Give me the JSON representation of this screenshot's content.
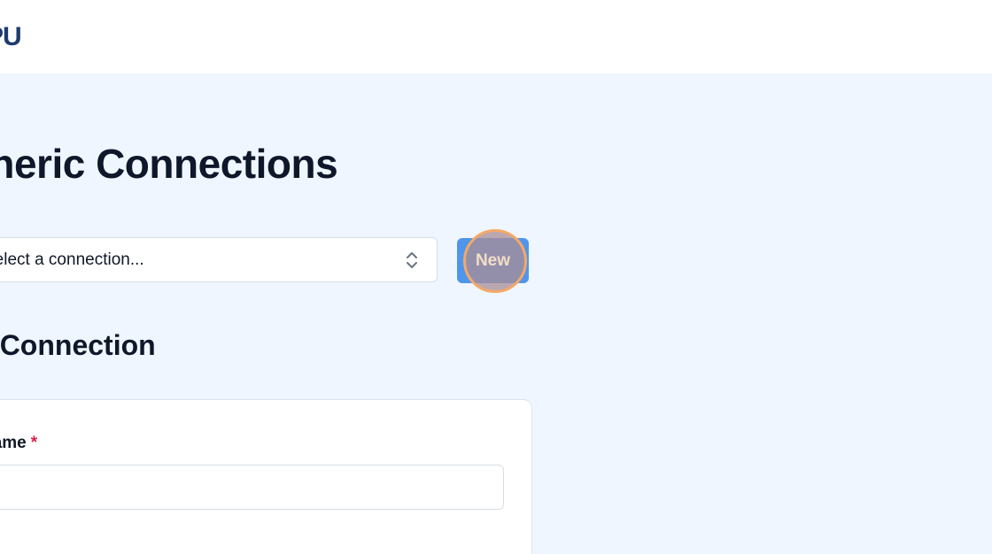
{
  "header": {
    "logo_text": "PU"
  },
  "main": {
    "page_title": "Generic Connections",
    "connection_select": {
      "value": "Select a connection...",
      "icon": "chevron-up-down-icon"
    },
    "new_button": {
      "label": "New"
    },
    "section_title": "New Connection",
    "form": {
      "name_field": {
        "label": "Name",
        "required_mark": "*",
        "value": ""
      }
    }
  },
  "colors": {
    "background": "#eff6ff",
    "primary_button": "#4f96ea",
    "heading": "#0f172a",
    "required": "#e11d48",
    "logo": "#1e3a6e"
  }
}
